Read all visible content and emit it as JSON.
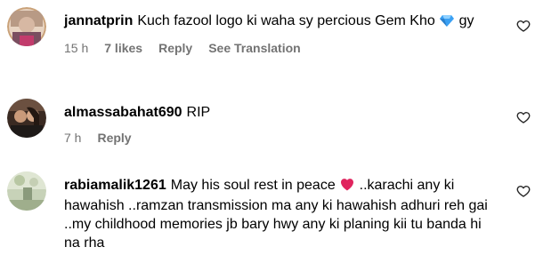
{
  "comments": [
    {
      "username": "jannatprin",
      "text_before": "Kuch fazool logo ki waha sy percious Gem Kho ",
      "text_after": " gy",
      "time": "15 h",
      "likes": "7 likes",
      "reply": "Reply",
      "translation": "See Translation"
    },
    {
      "username": "almassabahat690",
      "text_before": "RIP",
      "time": "7 h",
      "reply": "Reply"
    },
    {
      "username": "rabiamalik1261",
      "text_before": "May his soul rest in peace ",
      "text_after": " ..karachi any ki hawahish ..ramzan transmission ma any ki hawahish adhuri reh gai ..my childhood memories jb bary hwy any ki planing kii tu banda hi na rha"
    }
  ],
  "colors": {
    "meta": "#737373",
    "heart": "#e0245e",
    "gem": "#3aa0f3"
  }
}
